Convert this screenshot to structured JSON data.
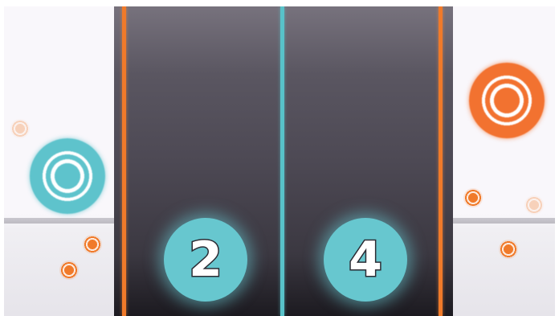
{
  "scoreboard": {
    "player_score": "2",
    "opponent_score": "4"
  },
  "colors": {
    "player": "#67c7cf",
    "opponent": "#f27230",
    "arena": "#4d4954",
    "side_panel": "#f9f7fb"
  },
  "icons": {
    "player_target": "teal-concentric-target-icon",
    "opponent_target": "orange-concentric-target-icon",
    "projectile": "orange-ring-dot-icon"
  }
}
